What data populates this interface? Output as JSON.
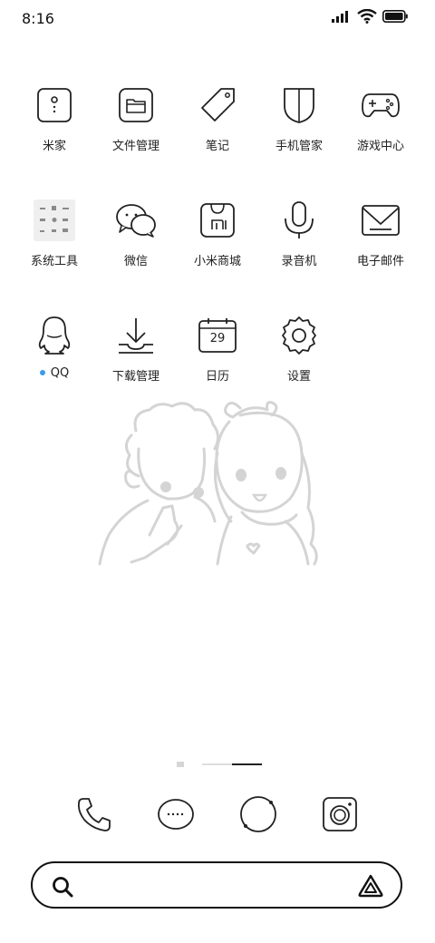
{
  "status_bar": {
    "time": "8:16"
  },
  "apps": [
    {
      "label": "米家",
      "icon": "mijia-icon"
    },
    {
      "label": "文件管理",
      "icon": "folder-icon"
    },
    {
      "label": "笔记",
      "icon": "tag-icon"
    },
    {
      "label": "手机管家",
      "icon": "shield-icon"
    },
    {
      "label": "游戏中心",
      "icon": "gamepad-icon"
    },
    {
      "label": "系统工具",
      "icon": "tools-folder-icon"
    },
    {
      "label": "微信",
      "icon": "wechat-icon"
    },
    {
      "label": "小米商城",
      "icon": "mi-store-icon"
    },
    {
      "label": "录音机",
      "icon": "microphone-icon"
    },
    {
      "label": "电子邮件",
      "icon": "mail-icon"
    },
    {
      "label": "QQ",
      "icon": "penguin-icon",
      "new_dot": true
    },
    {
      "label": "下载管理",
      "icon": "download-icon"
    },
    {
      "label": "日历",
      "icon": "calendar-icon",
      "date": "29"
    },
    {
      "label": "设置",
      "icon": "gear-icon"
    }
  ],
  "dock": [
    "phone-icon",
    "messages-icon",
    "browser-icon",
    "camera-icon"
  ],
  "search": {
    "placeholder": ""
  },
  "colors": {
    "accent_dot": "#3a9bea",
    "outline": "#222222",
    "wallpaper_line": "#d4d4d4"
  }
}
